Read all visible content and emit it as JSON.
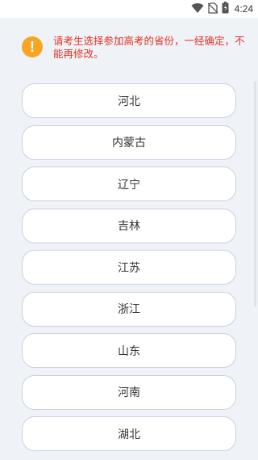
{
  "status_bar": {
    "time": "4:24",
    "icons": [
      "wifi-icon",
      "no-sim-icon",
      "battery-icon"
    ]
  },
  "notice": {
    "icon": "exclamation-icon",
    "icon_color": "#f6a623",
    "text": "请考生选择参加高考的省份，一经确定，不能再修改。",
    "text_color": "#e0342a"
  },
  "provinces": [
    {
      "label": "河北"
    },
    {
      "label": "内蒙古"
    },
    {
      "label": "辽宁"
    },
    {
      "label": "吉林"
    },
    {
      "label": "江苏"
    },
    {
      "label": "浙江"
    },
    {
      "label": "山东"
    },
    {
      "label": "河南"
    },
    {
      "label": "湖北"
    }
  ]
}
